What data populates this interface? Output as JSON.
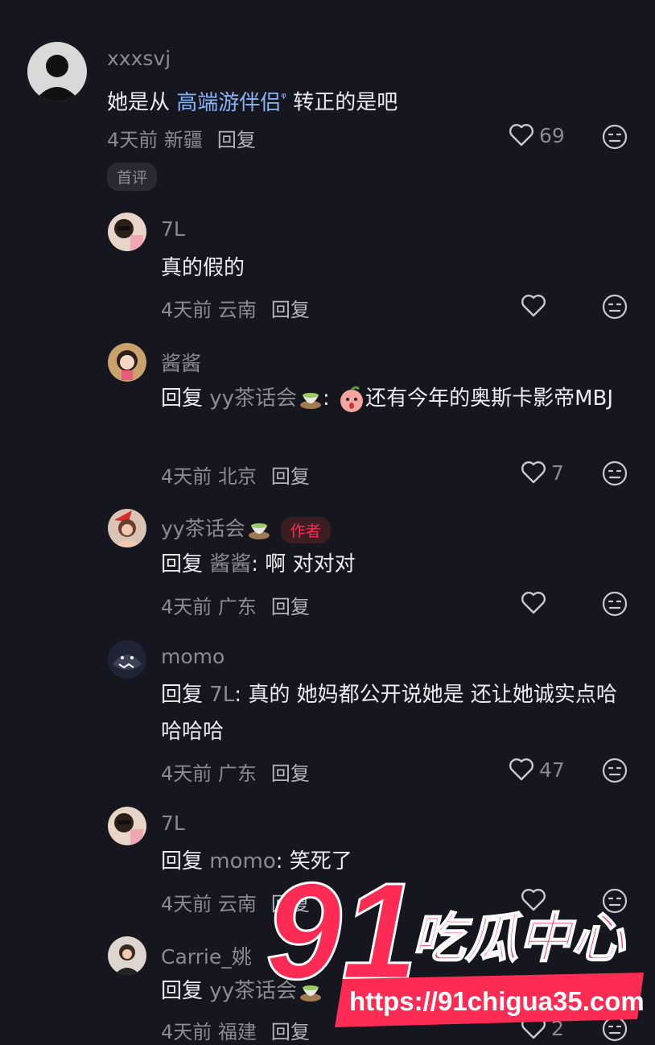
{
  "comments": [
    {
      "user": "xxxsvj",
      "text_pre": "她是从 ",
      "link": "高端游伴侣",
      "link_suffix": "ᵠ",
      "text_post": " 转正的是吧",
      "time": "4天前 新疆",
      "reply": "回复",
      "likes": "69",
      "badge": "首评"
    },
    {
      "user": "7L",
      "text": "真的假的",
      "time": "4天前 云南",
      "reply": "回复",
      "likes": ""
    },
    {
      "user": "酱酱",
      "reply_prefix": "回复 ",
      "reply_to": "yy茶话会",
      "text": "还有今年的奥斯卡影帝MBJ",
      "time": "4天前 北京",
      "reply": "回复",
      "likes": "7"
    },
    {
      "user": "yy茶话会",
      "author_badge": "作者",
      "reply_prefix": "回复 ",
      "reply_to": "酱酱",
      "text": ": 啊 对对对",
      "time": "4天前 广东",
      "reply": "回复",
      "likes": ""
    },
    {
      "user": "momo",
      "reply_prefix": "回复 ",
      "reply_to": "7L",
      "text": ": 真的 她妈都公开说她是 还让她诚实点哈哈哈哈",
      "time": "4天前 广东",
      "reply": "回复",
      "likes": "47"
    },
    {
      "user": "7L",
      "reply_prefix": "回复 ",
      "reply_to": "momo",
      "text": ": 笑死了",
      "time": "4天前 云南",
      "reply": "回复",
      "likes": ""
    },
    {
      "user": "Carrie_姚",
      "reply_prefix": "回复 ",
      "reply_to": "yy茶话会",
      "time": "4天前 福建",
      "reply": "回复",
      "likes": "2"
    }
  ],
  "watermark": {
    "number": "91",
    "name": "吃瓜中心",
    "url": "https://91chigua35.com"
  },
  "colors": {
    "background": "#16161e",
    "accent": "#fe2c55",
    "link": "#8ab4f8"
  }
}
